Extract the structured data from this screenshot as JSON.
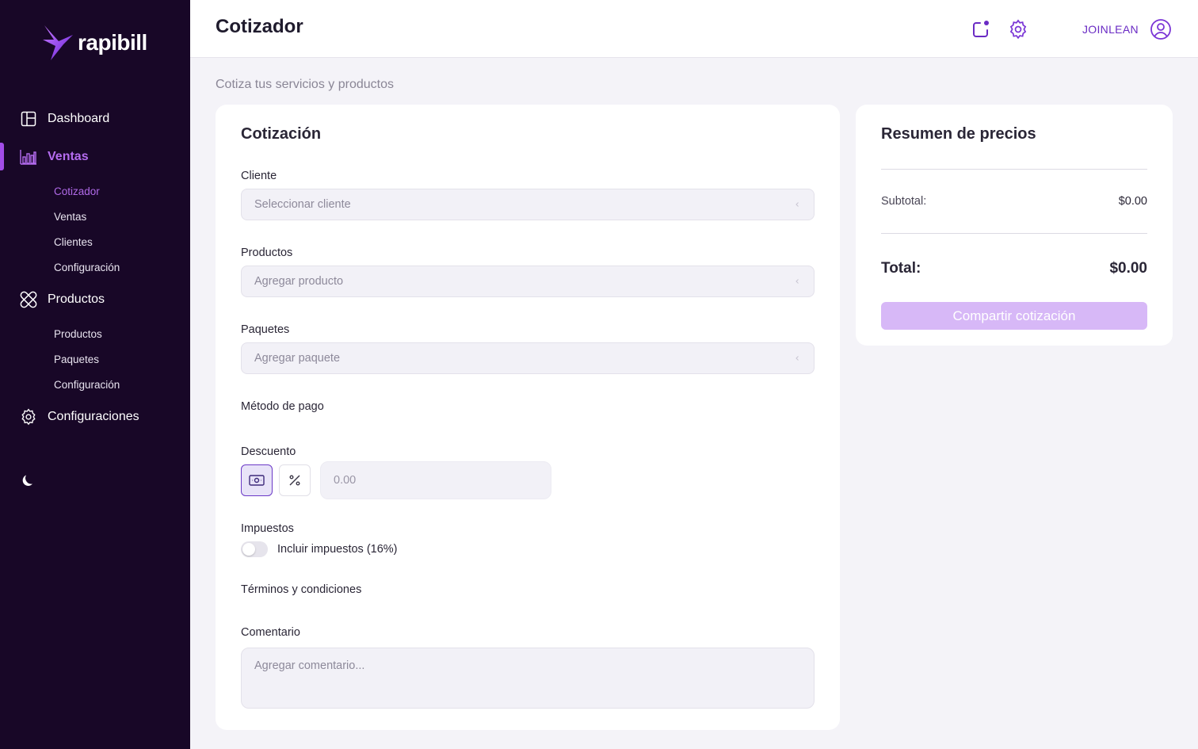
{
  "brand": {
    "name": "rapibill",
    "accent": "#8b3ee6",
    "sidebar_bg": "#180727"
  },
  "sidebar": {
    "items": [
      {
        "label": "Dashboard",
        "icon": "layout-icon"
      },
      {
        "label": "Ventas",
        "icon": "bar-chart-icon",
        "active": true,
        "children": [
          {
            "label": "Cotizador",
            "active": true
          },
          {
            "label": "Ventas"
          },
          {
            "label": "Clientes"
          },
          {
            "label": "Configuración"
          }
        ]
      },
      {
        "label": "Productos",
        "icon": "bandage-icon",
        "children": [
          {
            "label": "Productos"
          },
          {
            "label": "Paquetes"
          },
          {
            "label": "Configuración"
          }
        ]
      },
      {
        "label": "Configuraciones",
        "icon": "gear-icon"
      }
    ],
    "theme_icon": "moon-icon"
  },
  "header": {
    "title": "Cotizador",
    "notification_icon": "notification-icon",
    "settings_icon": "gear-icon",
    "user": "JOINLEAN",
    "user_icon": "user-circle-icon"
  },
  "page": {
    "subtitle": "Cotiza tus servicios y productos"
  },
  "quote": {
    "title": "Cotización",
    "client": {
      "label": "Cliente",
      "placeholder": "Seleccionar cliente"
    },
    "products": {
      "label": "Productos",
      "placeholder": "Agregar producto"
    },
    "packages": {
      "label": "Paquetes",
      "placeholder": "Agregar paquete"
    },
    "payment_method": {
      "label": "Método de pago"
    },
    "discount": {
      "label": "Descuento",
      "placeholder": "0.00",
      "selected_mode": "amount"
    },
    "taxes": {
      "label": "Impuestos",
      "toggle_label": "Incluir impuestos (16%)",
      "enabled": false
    },
    "terms": {
      "label": "Términos y condiciones"
    },
    "comment": {
      "label": "Comentario",
      "placeholder": "Agregar comentario..."
    }
  },
  "summary": {
    "title": "Resumen de precios",
    "subtotal_label": "Subtotal:",
    "subtotal_value": "$0.00",
    "total_label": "Total:",
    "total_value": "$0.00",
    "share_label": "Compartir cotización"
  }
}
